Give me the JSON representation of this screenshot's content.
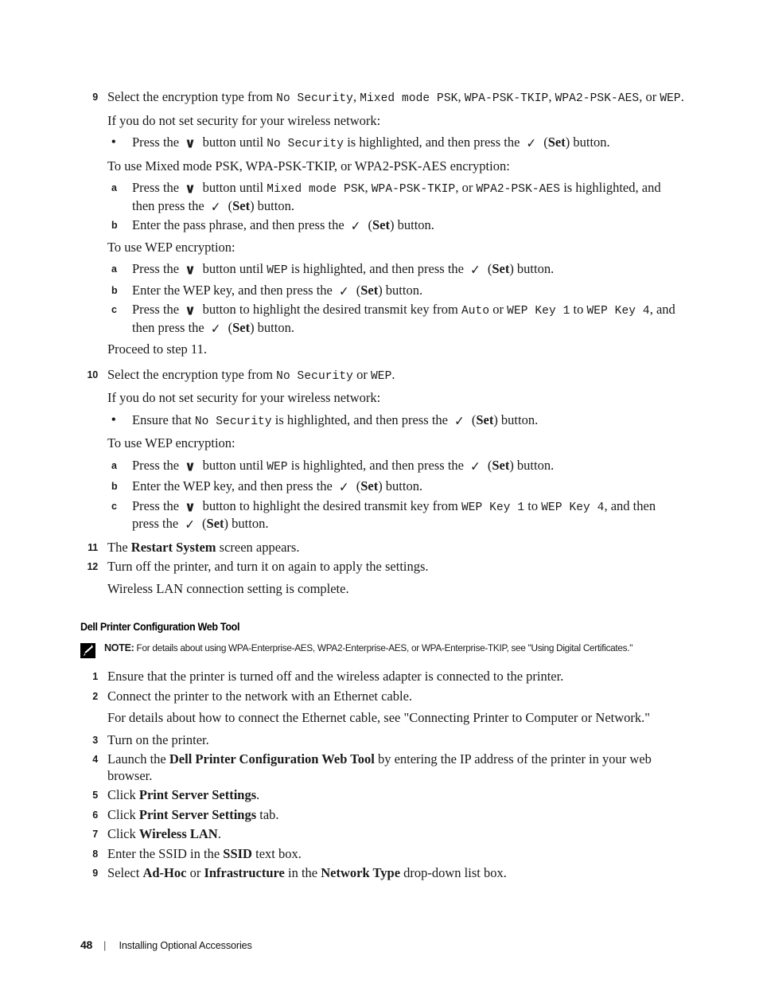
{
  "footer": {
    "page_number": "48",
    "separator": "|",
    "title": "Installing Optional Accessories"
  },
  "glyphs": {
    "down_button": "∨",
    "set_button": "✓",
    "bullet": "•"
  },
  "steps": {
    "s9": {
      "num": "9",
      "t1": "Select the encryption type from ",
      "c1": "No Security",
      "t2": ", ",
      "c2": "Mixed mode PSK",
      "t3": ", ",
      "c3": "WPA-PSK-TKIP",
      "t4": ", ",
      "c4": "WPA2-PSK-AES",
      "t5": ", or ",
      "c5": "WEP",
      "t6": "."
    },
    "s9_para1": "If you do not set security for your wireless network:",
    "s9_bullet": {
      "mark": "•",
      "t1": "Press the ",
      "glyph1": "∨",
      "t2": " button until ",
      "c1": "No Security",
      "t3": " is highlighted, and then press the ",
      "glyph2": "✓",
      "t4": " (",
      "set": "Set",
      "t5": ") button."
    },
    "s9_para2": "To use Mixed mode PSK, WPA-PSK-TKIP, or WPA2-PSK-AES encryption:",
    "s9_a": {
      "mark": "a",
      "t1": "Press the ",
      "glyph1": "∨",
      "t2": " button until ",
      "c1": "Mixed mode PSK",
      "t3": ", ",
      "c2": "WPA-PSK-TKIP",
      "t4": ", or ",
      "c3": "WPA2-PSK-AES",
      "t5": " is highlighted, and then press the ",
      "glyph2": "✓",
      "t6": " (",
      "set": "Set",
      "t7": ") button."
    },
    "s9_b": {
      "mark": "b",
      "t1": "Enter the pass phrase, and then press the ",
      "glyph1": "✓",
      "t2": " (",
      "set": "Set",
      "t3": ") button."
    },
    "s9_para3": "To use WEP encryption:",
    "s9_wep_a": {
      "mark": "a",
      "t1": "Press the ",
      "glyph1": "∨",
      "t2": " button until ",
      "c1": "WEP",
      "t3": " is highlighted, and then press the ",
      "glyph2": "✓",
      "t4": " (",
      "set": "Set",
      "t5": ") button."
    },
    "s9_wep_b": {
      "mark": "b",
      "t1": "Enter the WEP key, and then press the ",
      "glyph1": "✓",
      "t2": " (",
      "set": "Set",
      "t3": ") button."
    },
    "s9_wep_c": {
      "mark": "c",
      "t1": "Press the ",
      "glyph1": "∨",
      "t2": " button to highlight the desired transmit key from ",
      "c1": "Auto",
      "t3": " or ",
      "c2": "WEP Key 1",
      "t4": " to ",
      "c3": "WEP Key 4",
      "t5": ", and then press the ",
      "glyph2": "✓",
      "t6": " (",
      "set": "Set",
      "t7": ") button."
    },
    "s9_proceed": "Proceed to step 11.",
    "s10": {
      "num": "10",
      "t1": "Select the encryption type from ",
      "c1": "No Security",
      "t2": " or ",
      "c2": "WEP",
      "t3": "."
    },
    "s10_para1": "If you do not set security for your wireless network:",
    "s10_bullet": {
      "mark": "•",
      "t1": "Ensure that ",
      "c1": "No Security",
      "t2": " is highlighted, and then press the ",
      "glyph1": "✓",
      "t3": " (",
      "set": "Set",
      "t4": ") button."
    },
    "s10_para2": "To use WEP encryption:",
    "s10_a": {
      "mark": "a",
      "t1": "Press the ",
      "glyph1": "∨",
      "t2": " button until ",
      "c1": "WEP",
      "t3": " is highlighted, and then press the ",
      "glyph2": "✓",
      "t4": " (",
      "set": "Set",
      "t5": ") button."
    },
    "s10_b": {
      "mark": "b",
      "t1": "Enter the WEP key, and then press the ",
      "glyph1": "✓",
      "t2": " (",
      "set": "Set",
      "t3": ") button."
    },
    "s10_c": {
      "mark": "c",
      "t1": "Press the ",
      "glyph1": "∨",
      "t2": " button to highlight the desired transmit key from ",
      "c1": "WEP Key 1",
      "t3": " to ",
      "c2": "WEP Key 4",
      "t4": ", and then press the ",
      "glyph2": "✓",
      "t5": " (",
      "set": "Set",
      "t6": ") button."
    },
    "s11": {
      "num": "11",
      "t1": "The ",
      "b1": "Restart System",
      "t2": " screen appears."
    },
    "s12": {
      "num": "12",
      "t1": "Turn off the printer, and turn it on again to apply the settings."
    },
    "s12_para": "Wireless LAN connection setting is complete."
  },
  "section": {
    "heading": "Dell Printer Configuration Web Tool",
    "note": {
      "icon": "note-pencil-icon",
      "label": "NOTE:",
      "text": " For details about using WPA-Enterprise-AES, WPA2-Enterprise-AES, or WPA-Enterprise-TKIP, see \"Using Digital Certificates.\""
    },
    "steps": {
      "w1": {
        "num": "1",
        "t1": "Ensure that the printer is turned off and the wireless adapter is connected to the printer."
      },
      "w2": {
        "num": "2",
        "t1": "Connect the printer to the network with an Ethernet cable."
      },
      "w2_para": "For details about how to connect the Ethernet cable, see \"Connecting Printer to Computer or Network.\"",
      "w3": {
        "num": "3",
        "t1": "Turn on the printer."
      },
      "w4": {
        "num": "4",
        "t1": "Launch the ",
        "b1": "Dell Printer Configuration Web Tool",
        "t2": " by entering the IP address of the printer in your web browser."
      },
      "w5": {
        "num": "5",
        "t1": "Click ",
        "b1": "Print Server Settings",
        "t2": "."
      },
      "w6": {
        "num": "6",
        "t1": "Click ",
        "b1": "Print Server Settings",
        "t2": " tab."
      },
      "w7": {
        "num": "7",
        "t1": "Click ",
        "b1": "Wireless LAN",
        "t2": "."
      },
      "w8": {
        "num": "8",
        "t1": "Enter the SSID in the ",
        "b1": "SSID",
        "t2": " text box."
      },
      "w9": {
        "num": "9",
        "t1": "Select ",
        "b1": "Ad-Hoc",
        "t2": " or ",
        "b2": "Infrastructure",
        "t3": " in the ",
        "b3": "Network Type",
        "t4": " drop-down list box."
      }
    }
  }
}
